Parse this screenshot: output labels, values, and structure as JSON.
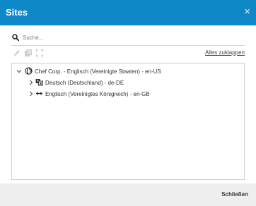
{
  "dialog": {
    "title": "Sites",
    "close_glyph": "×"
  },
  "search": {
    "placeholder": "Suche..."
  },
  "toolbar": {
    "icons": [
      "pencil-icon",
      "copy-icon",
      "expand-icon"
    ],
    "collapse_all_label": "Alles zuklappen"
  },
  "tree": {
    "root": {
      "label": "Chef Corp. - Englisch (Vereinigte Staaten) - en-US",
      "icon": "globe-icon",
      "expanded": true
    },
    "children": [
      {
        "label": "Deutsch (Deutschland) - de-DE",
        "icon": "translate-icon",
        "expanded": false
      },
      {
        "label": "Englisch (Vereinigtes Königreich) - en-GB",
        "icon": "arrows-icon",
        "expanded": false
      }
    ]
  },
  "footer": {
    "close_label": "Schließen"
  },
  "colors": {
    "title_bar": "#0e88c6",
    "footer_bg": "#eeeeee"
  }
}
